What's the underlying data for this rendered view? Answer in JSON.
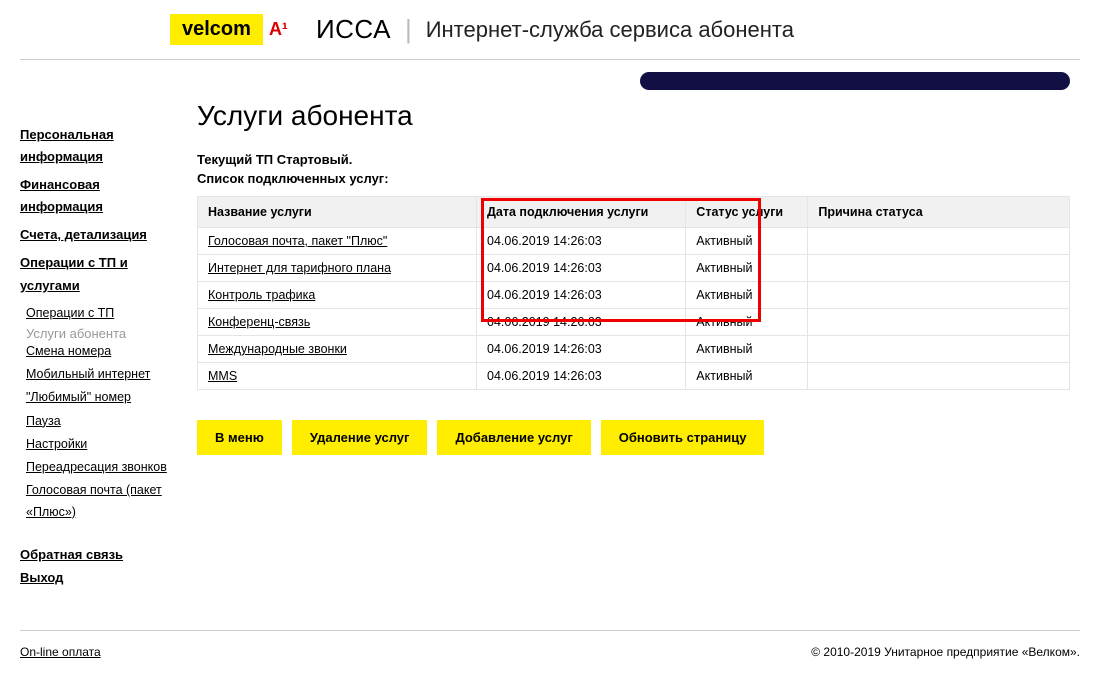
{
  "header": {
    "logo": "velcom",
    "logo2": "A¹",
    "brand": "ИССА",
    "subtitle": "Интернет-служба сервиса абонента"
  },
  "sidebar": {
    "main": [
      "Персональная информация",
      "Финансовая информация",
      "Счета, детализация",
      "Операции с ТП и услугами"
    ],
    "sub": [
      "Операции с ТП",
      "Услуги абонента",
      "Смена номера",
      "Мобильный интернет",
      "\"Любимый\" номер",
      "Пауза",
      "Настройки",
      "Переадресация звонков",
      "Голосовая почта (пакет «Плюс»)"
    ],
    "foot": [
      "Обратная связь",
      "Выход"
    ]
  },
  "main": {
    "title": "Услуги абонента",
    "tp": "Текущий ТП Стартовый.",
    "list_label": "Список подключенных услуг:",
    "columns": [
      "Название услуги",
      "Дата подключения услуги",
      "Статус услуги",
      "Причина статуса"
    ],
    "rows": [
      {
        "name": "Голосовая почта, пакет \"Плюс\"",
        "date": "04.06.2019 14:26:03",
        "status": "Активный",
        "reason": ""
      },
      {
        "name": "Интернет для тарифного плана",
        "date": "04.06.2019 14:26:03",
        "status": "Активный",
        "reason": ""
      },
      {
        "name": "Контроль трафика",
        "date": "04.06.2019 14:26:03",
        "status": "Активный",
        "reason": ""
      },
      {
        "name": "Конференц-связь",
        "date": "04.06.2019 14:26:03",
        "status": "Активный",
        "reason": ""
      },
      {
        "name": "Международные звонки",
        "date": "04.06.2019 14:26:03",
        "status": "Активный",
        "reason": ""
      },
      {
        "name": "MMS",
        "date": "04.06.2019 14:26:03",
        "status": "Активный",
        "reason": ""
      }
    ],
    "buttons": [
      "В меню",
      "Удаление услуг",
      "Добавление услуг",
      "Обновить страницу"
    ]
  },
  "footer": {
    "left": "On-line оплата",
    "right": "© 2010-2019 Унитарное предприятие «Велком»."
  }
}
